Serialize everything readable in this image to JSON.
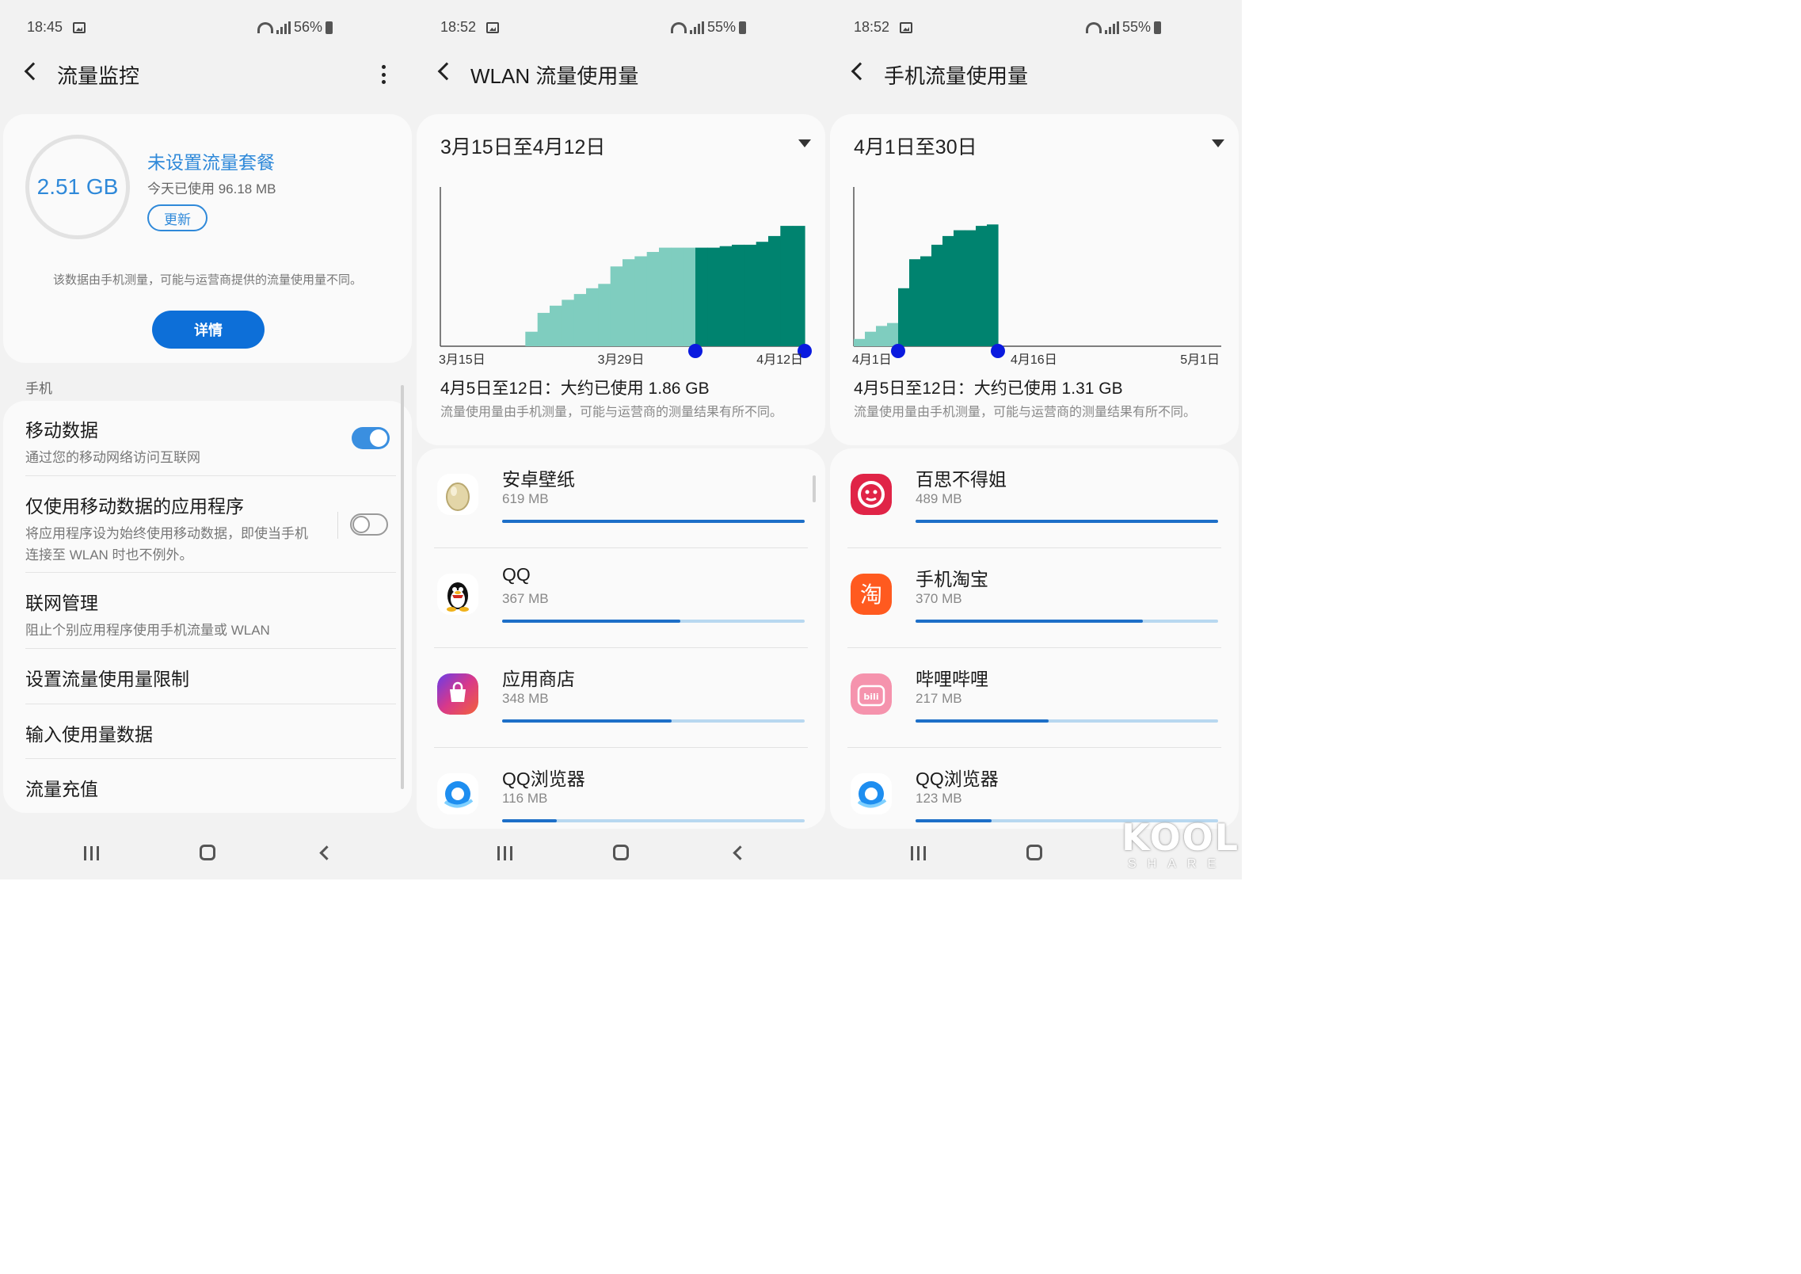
{
  "screens": [
    {
      "status": {
        "time": "18:45",
        "battery": "56%"
      },
      "title": "流量监控",
      "plan": {
        "used": "2.51 GB",
        "title": "未设置流量套餐",
        "today": "今天已使用 96.18 MB",
        "update_label": "更新",
        "note": "该数据由手机测量，可能与运营商提供的流量使用量不同。",
        "details_label": "详情"
      },
      "section_label": "手机",
      "items": [
        {
          "title": "移动数据",
          "subtitle": "通过您的移动网络访问互联网",
          "toggle": "on"
        },
        {
          "title": "仅使用移动数据的应用程序",
          "subtitle": "将应用程序设为始终使用移动数据，即使当手机连接至 WLAN 时也不例外。",
          "toggle": "off"
        },
        {
          "title": "联网管理",
          "subtitle": "阻止个别应用程序使用手机流量或 WLAN"
        },
        {
          "title": "设置流量使用量限制"
        },
        {
          "title": "输入使用量数据"
        },
        {
          "title": "流量充值"
        }
      ]
    },
    {
      "status": {
        "time": "18:52",
        "battery": "55%"
      },
      "title": "WLAN 流量使用量",
      "range": "3月15日至4月12日",
      "tick_labels": [
        "3月15日",
        "3月29日",
        "4月12日"
      ],
      "summary": "4月5日至12日：大约已使用 1.86 GB",
      "note": "流量使用量由手机测量，可能与运营商的测量结果有所不同。",
      "apps": [
        {
          "name": "安卓壁纸",
          "size": "619 MB",
          "icon": "egg-wallpaper-icon",
          "fraction": 1.0
        },
        {
          "name": "QQ",
          "size": "367 MB",
          "icon": "qq-penguin-icon",
          "fraction": 0.59
        },
        {
          "name": "应用商店",
          "size": "348 MB",
          "icon": "app-store-bag-icon",
          "fraction": 0.56
        },
        {
          "name": "QQ浏览器",
          "size": "116 MB",
          "icon": "qq-browser-icon",
          "fraction": 0.18
        }
      ]
    },
    {
      "status": {
        "time": "18:52",
        "battery": "55%"
      },
      "title": "手机流量使用量",
      "range": "4月1日至30日",
      "tick_labels": [
        "4月1日",
        "4月16日",
        "5月1日"
      ],
      "summary": "4月5日至12日：大约已使用 1.31 GB",
      "note": "流量使用量由手机测量，可能与运营商的测量结果有所不同。",
      "apps": [
        {
          "name": "百思不得姐",
          "size": "489 MB",
          "icon": "baisi-icon",
          "fraction": 1.0
        },
        {
          "name": "手机淘宝",
          "size": "370 MB",
          "icon": "taobao-icon",
          "fraction": 0.75
        },
        {
          "name": "哔哩哔哩",
          "size": "217 MB",
          "icon": "bilibili-icon",
          "fraction": 0.44
        },
        {
          "name": "QQ浏览器",
          "size": "123 MB",
          "icon": "qq-browser-icon",
          "fraction": 0.25
        }
      ]
    }
  ],
  "watermark": {
    "main": "KOOL",
    "sub": "SHARE"
  },
  "colors": {
    "accent": "#2f89d9",
    "button": "#0d6fd8",
    "chart_light": "#7fcdbf",
    "chart_dark": "#00836f",
    "handle": "#0a1adf",
    "bar": "#1d6fc8",
    "bar_track": "#b8d8f0"
  },
  "chart_data": [
    {
      "type": "area",
      "x_start": "3月15日",
      "x_end": "4月12日",
      "xlabels": [
        "3月15日",
        "3月29日",
        "4月12日"
      ],
      "highlight_range": [
        "4月5日",
        "4月12日"
      ],
      "highlight_total_gb": 1.86,
      "cumulative_fraction": [
        0,
        0,
        0,
        0,
        0,
        0,
        0,
        0.1,
        0.23,
        0.28,
        0.32,
        0.36,
        0.4,
        0.43,
        0.55,
        0.6,
        0.62,
        0.65,
        0.68,
        0.68,
        0.68,
        0.68,
        0.68,
        0.69,
        0.7,
        0.7,
        0.72,
        0.76,
        0.83,
        0.83
      ]
    },
    {
      "type": "area",
      "x_start": "4月1日",
      "x_end": "5月1日",
      "xlabels": [
        "4月1日",
        "4月16日",
        "5月1日"
      ],
      "highlight_range": [
        "4月5日",
        "4月12日"
      ],
      "highlight_total_gb": 1.31,
      "cumulative_fraction": [
        0.05,
        0.1,
        0.14,
        0.16,
        0.4,
        0.6,
        0.62,
        0.7,
        0.76,
        0.8,
        0.8,
        0.83,
        0.84
      ]
    }
  ]
}
